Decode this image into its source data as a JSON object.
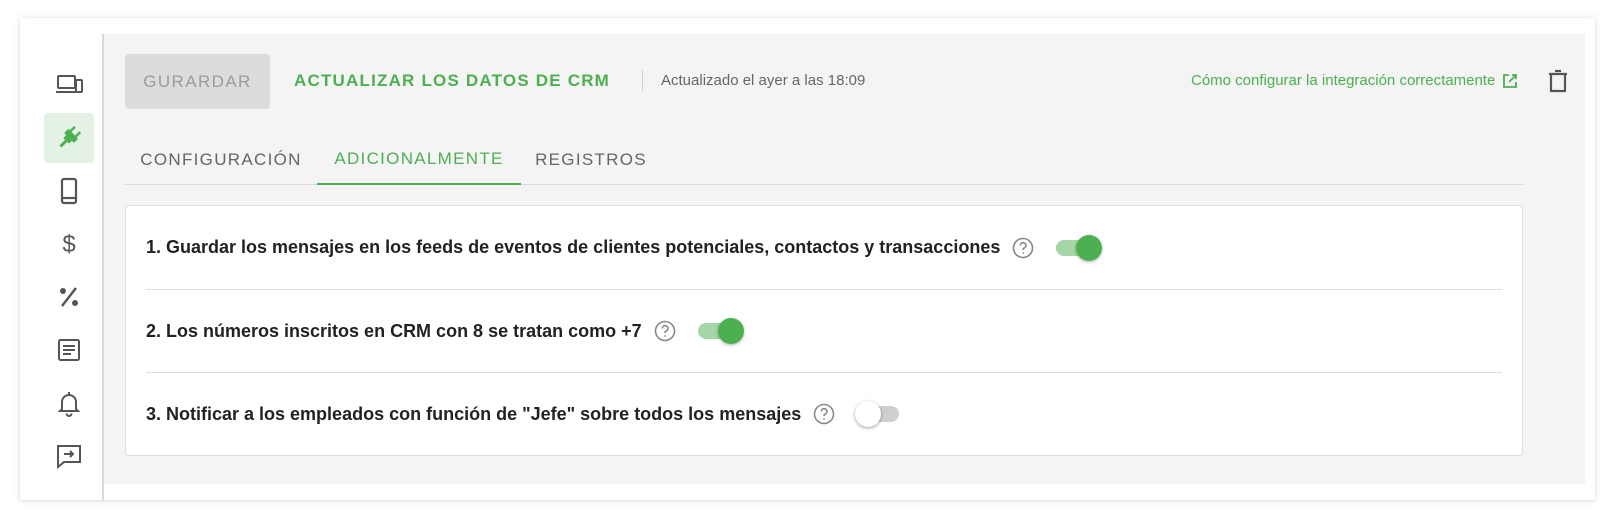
{
  "colors": {
    "accent": "#4caf50",
    "accent_light": "#a5d6a7",
    "active_bg": "#e3f2e4",
    "icon": "#555555"
  },
  "sidebar": {
    "items": [
      {
        "icon": "devices-icon",
        "active": false
      },
      {
        "icon": "plug-icon",
        "active": true
      },
      {
        "icon": "phone-icon",
        "active": false
      },
      {
        "icon": "dollar-icon",
        "active": false
      },
      {
        "icon": "percent-icon",
        "active": false
      },
      {
        "icon": "document-icon",
        "active": false
      },
      {
        "icon": "bell-icon",
        "active": false
      },
      {
        "icon": "message-forward-icon",
        "active": false
      }
    ]
  },
  "toolbar": {
    "save_label": "GURARDAR",
    "update_label": "ACTUALIZAR LOS DATOS DE CRM",
    "updated_text": "Actualizado el ayer a las 18:09",
    "help_link": "Cómo configurar la integración correctamente",
    "help_icon": "external-link-icon",
    "delete_icon": "trash-icon"
  },
  "tabs": [
    {
      "label": "CONFIGURACIÓN",
      "active": false
    },
    {
      "label": "ADICIONALMENTE",
      "active": true
    },
    {
      "label": "REGISTROS",
      "active": false
    }
  ],
  "options": [
    {
      "text": "1. Guardar los mensajes en los feeds de eventos de clientes potenciales, contactos y transacciones",
      "enabled": true
    },
    {
      "text": "2. Los números inscritos en CRM con 8 se tratan como +7",
      "enabled": true
    },
    {
      "text": "3. Notificar a los empleados con función de \"Jefe\" sobre todos los mensajes",
      "enabled": false
    }
  ]
}
